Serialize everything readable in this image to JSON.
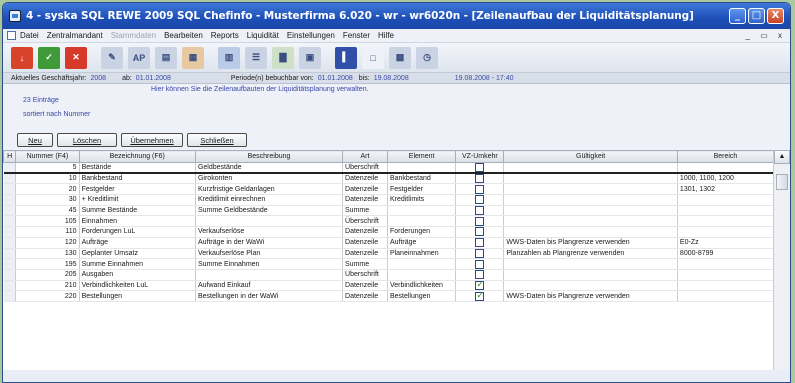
{
  "window": {
    "title": "4 - syska SQL REWE 2009 SQL Chefinfo - Musterfirma 6.020 - wr - wr6020n - [Zeilenaufbau der Liquiditätsplanung]",
    "minimize_label": "_",
    "maximize_label": "□",
    "close_label": "X"
  },
  "menu": {
    "items": [
      "Datei",
      "Zentralmandant",
      "Stammdaten",
      "Bearbeiten",
      "Reports",
      "Liquidität",
      "Einstellungen",
      "Fenster",
      "Hilfe"
    ],
    "disabled": [
      "Stammdaten"
    ],
    "mdi_controls": "_ ▭ x"
  },
  "toolbar": {
    "buttons": [
      {
        "icon": "download-arrow-icon",
        "color": "#d8432b",
        "glyph": "↓"
      },
      {
        "icon": "check-circle-icon",
        "color": "#3f9a3a",
        "glyph": "✓"
      },
      {
        "icon": "cancel-x-icon",
        "color": "#d83a2a",
        "glyph": "✕"
      },
      {
        "icon": "edit-document-icon",
        "color": "#c9d3e4",
        "glyph": "✎"
      },
      {
        "icon": "ap-report-icon",
        "color": "#c9d3e4",
        "glyph": "AP"
      },
      {
        "icon": "page-icon",
        "color": "#c9d3e4",
        "glyph": "▤"
      },
      {
        "icon": "gallery-icon",
        "color": "#e6c9a0",
        "glyph": "▦"
      },
      {
        "icon": "sheet-icon",
        "color": "#b9cbe6",
        "glyph": "▥"
      },
      {
        "icon": "list-icon",
        "color": "#c9d3e4",
        "glyph": "☰"
      },
      {
        "icon": "bar-chart-icon",
        "color": "#cfe0c8",
        "glyph": "▇"
      },
      {
        "icon": "calculator-icon",
        "color": "#c9d3e4",
        "glyph": "▣"
      },
      {
        "icon": "panel-blue-icon",
        "color": "#2f4fa8",
        "glyph": "▍"
      },
      {
        "icon": "blank-page-icon",
        "color": "#eef1f7",
        "glyph": "□"
      },
      {
        "icon": "save-disk-icon",
        "color": "#c9d3e4",
        "glyph": "▩"
      },
      {
        "icon": "clock-icon",
        "color": "#c9d3e4",
        "glyph": "◷"
      }
    ],
    "separators_after": [
      2,
      6,
      10
    ]
  },
  "infobar": {
    "fiscal_year_label": "Aktuelles Geschäftsjahr:",
    "fiscal_year_value": "2008",
    "from_label": "ab:",
    "from_value": "01.01.2008",
    "period_label": "Periode(n) bebuchbar von:",
    "period_from": "01.01.2008",
    "to_label": "bis:",
    "period_to": "19.08.2008",
    "timestamp": "19.08.2008 - 17:40"
  },
  "panel": {
    "hint": "Hier können Sie die Zeilenaufbauten der Liquiditätsplanung verwalten.",
    "count": "23 Einträge",
    "sort": "sortiert nach Nummer"
  },
  "buttons": {
    "new": "Neu",
    "delete": "Löschen",
    "apply": "Übernehmen",
    "close": "Schließen"
  },
  "table": {
    "headers": [
      "H",
      "Nummer (F4)",
      "Bezeichnung (F6)",
      "Beschreibung",
      "Art",
      "Element",
      "VZ-Umkehr",
      "Gültigkeit",
      "Bereich"
    ],
    "current_row_marker": "▶",
    "rows": [
      {
        "num": "5",
        "name": "Bestände",
        "desc": "Geldbestände",
        "art": "Überschrift",
        "element": "",
        "vz": false,
        "valid": "",
        "range": ""
      },
      {
        "num": "10",
        "name": "Bankbestand",
        "desc": "Girokonten",
        "art": "Datenzeile",
        "element": "Bankbestand",
        "vz": false,
        "valid": "",
        "range": "1000, 1100, 1200"
      },
      {
        "num": "20",
        "name": "Festgelder",
        "desc": "Kurzfristige Geldanlagen",
        "art": "Datenzeile",
        "element": "Festgelder",
        "vz": false,
        "valid": "",
        "range": "1301, 1302"
      },
      {
        "num": "30",
        "name": "+ Kreditlimit",
        "desc": "Kreditlimit einrechnen",
        "art": "Datenzeile",
        "element": "Kreditlimits",
        "vz": false,
        "valid": "",
        "range": ""
      },
      {
        "num": "45",
        "name": "Summe Bestände",
        "desc": "Summe Geldbestände",
        "art": "Summe",
        "element": "",
        "vz": false,
        "valid": "",
        "range": ""
      },
      {
        "num": "105",
        "name": "Einnahmen",
        "desc": "",
        "art": "Überschrift",
        "element": "",
        "vz": false,
        "valid": "",
        "range": ""
      },
      {
        "num": "110",
        "name": "Forderungen LuL",
        "desc": "Verkaufserlöse",
        "art": "Datenzeile",
        "element": "Forderungen",
        "vz": false,
        "valid": "",
        "range": ""
      },
      {
        "num": "120",
        "name": "Aufträge",
        "desc": "Aufträge in der WaWi",
        "art": "Datenzeile",
        "element": "Aufträge",
        "vz": false,
        "valid": "WWS-Daten bis Plangrenze verwenden",
        "range": "E0-Zz"
      },
      {
        "num": "130",
        "name": "Geplanter Umsatz",
        "desc": "Verkaufserlöse Plan",
        "art": "Datenzeile",
        "element": "Planeinnahmen",
        "vz": false,
        "valid": "Planzahlen ab Plangrenze verwenden",
        "range": "8000-8799"
      },
      {
        "num": "195",
        "name": "Summe Einnahmen",
        "desc": "Summe Einnahmen",
        "art": "Summe",
        "element": "",
        "vz": false,
        "valid": "",
        "range": ""
      },
      {
        "num": "205",
        "name": "Ausgaben",
        "desc": "",
        "art": "Überschrift",
        "element": "",
        "vz": false,
        "valid": "",
        "range": ""
      },
      {
        "num": "210",
        "name": "Verbindlichkeiten LuL",
        "desc": "Aufwand Einkauf",
        "art": "Datenzeile",
        "element": "Verbindlichkeiten",
        "vz": true,
        "valid": "",
        "range": ""
      },
      {
        "num": "220",
        "name": "Bestellungen",
        "desc": "Bestellungen in der WaWi",
        "art": "Datenzeile",
        "element": "Bestellungen",
        "vz": true,
        "valid": "WWS-Daten bis Plangrenze verwenden",
        "range": ""
      }
    ]
  },
  "scrollbar": {
    "up_label": "▲"
  },
  "colors": {
    "titlebar": "#1d4fb8",
    "link_text": "#3848a8",
    "checkmark": "#2c8a3a"
  }
}
